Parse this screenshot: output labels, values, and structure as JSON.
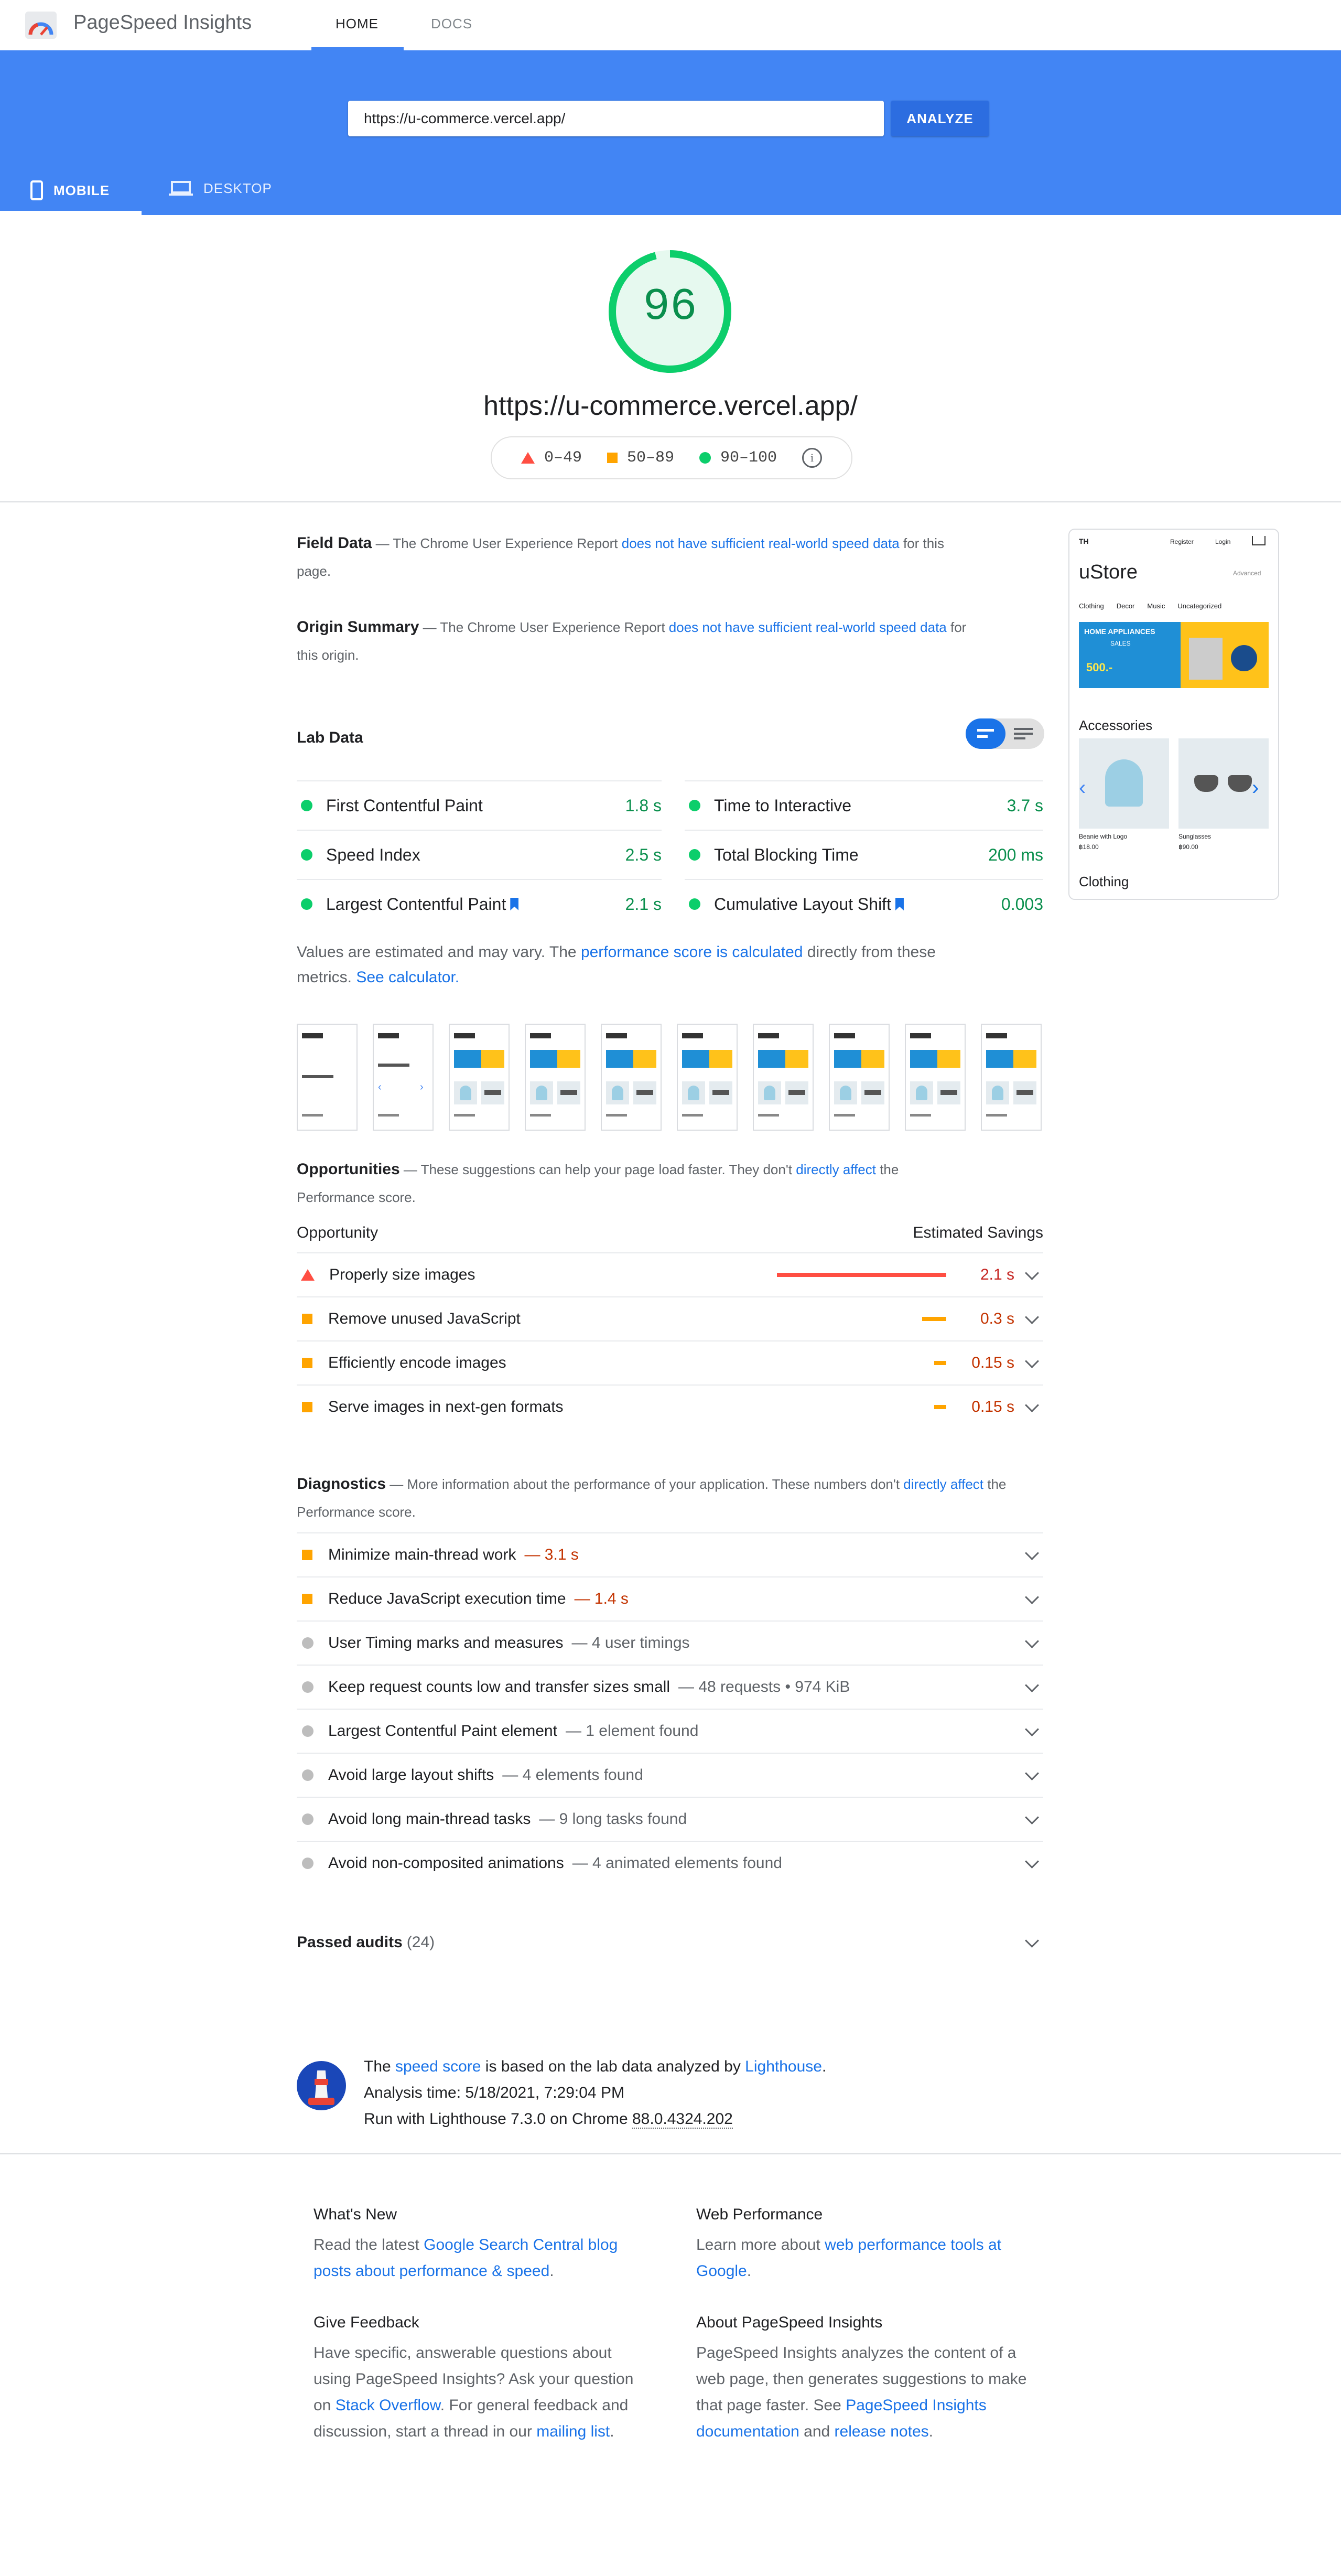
{
  "app": {
    "title": "PageSpeed Insights"
  },
  "nav": {
    "tabs": [
      {
        "label": "HOME",
        "active": true
      },
      {
        "label": "DOCS",
        "active": false
      }
    ]
  },
  "search": {
    "value": "https://u-commerce.vercel.app/",
    "analyze_label": "ANALYZE"
  },
  "devices": [
    {
      "label": "MOBILE",
      "icon": "phone-icon",
      "active": true
    },
    {
      "label": "DESKTOP",
      "icon": "laptop-icon",
      "active": false
    }
  ],
  "score": {
    "value": "96",
    "url": "https://u-commerce.vercel.app/",
    "legend": [
      "0–49",
      "50–89",
      "90–100"
    ],
    "color": "#0cce6b"
  },
  "field_data": {
    "title": "Field Data",
    "prefix": " — The Chrome User Experience Report ",
    "link": "does not have sufficient real-world speed data",
    "suffix": " for this page."
  },
  "origin_summary": {
    "title": "Origin Summary",
    "prefix": " — The Chrome User Experience Report ",
    "link": "does not have sufficient real-world speed data",
    "suffix": " for this origin."
  },
  "lab": {
    "title": "Lab Data",
    "metrics_left": [
      {
        "name": "First Contentful Paint",
        "value": "1.8 s"
      },
      {
        "name": "Speed Index",
        "value": "2.5 s"
      },
      {
        "name": "Largest Contentful Paint",
        "value": "2.1 s"
      }
    ],
    "metrics_right": [
      {
        "name": "Time to Interactive",
        "value": "3.7 s"
      },
      {
        "name": "Total Blocking Time",
        "value": "200 ms"
      },
      {
        "name": "Cumulative Layout Shift",
        "value": "0.003"
      }
    ],
    "note_prefix": "Values are estimated and may vary. The ",
    "note_link": "performance score is calculated",
    "note_mid": " directly from these metrics. ",
    "note_link2": "See calculator."
  },
  "preview": {
    "logo": "TH",
    "register": "Register",
    "login": "Login",
    "store": "uStore",
    "advanced": "Advanced",
    "cats": [
      "Clothing",
      "Decor",
      "Music",
      "Uncategorized"
    ],
    "banner_title": "HOME APPLIANCES",
    "banner_sale": "SALES",
    "banner_price": "500.-",
    "section": "Accessories",
    "products": [
      {
        "name": "Beanie with Logo",
        "price": "฿18.00"
      },
      {
        "name": "Sunglasses",
        "price": "฿90.00"
      }
    ],
    "section2": "Clothing"
  },
  "opportunities": {
    "title": "Opportunities",
    "desc_prefix": " — These suggestions can help your page load faster. They don't ",
    "desc_link": "directly affect",
    "desc_suffix": " the Performance score.",
    "col1": "Opportunity",
    "col2": "Estimated Savings",
    "items": [
      {
        "name": "Properly size images",
        "saving": "2.1 s",
        "level": "fail",
        "bar": 0.85
      },
      {
        "name": "Remove unused JavaScript",
        "saving": "0.3 s",
        "level": "average",
        "bar": 0.12
      },
      {
        "name": "Efficiently encode images",
        "saving": "0.15 s",
        "level": "average",
        "bar": 0.06
      },
      {
        "name": "Serve images in next-gen formats",
        "saving": "0.15 s",
        "level": "average",
        "bar": 0.06
      }
    ]
  },
  "diagnostics": {
    "title": "Diagnostics",
    "desc_prefix": " — More information about the performance of your application. These numbers don't ",
    "desc_link": "directly affect",
    "desc_suffix": " the Performance score.",
    "items": [
      {
        "name": "Minimize main-thread work",
        "detail": "— 3.1 s",
        "level": "average"
      },
      {
        "name": "Reduce JavaScript execution time",
        "detail": "— 1.4 s",
        "level": "average"
      },
      {
        "name": "User Timing marks and measures",
        "detail": "— 4 user timings",
        "level": "info"
      },
      {
        "name": "Keep request counts low and transfer sizes small",
        "detail": "— 48 requests • 974 KiB",
        "level": "info"
      },
      {
        "name": "Largest Contentful Paint element",
        "detail": "— 1 element found",
        "level": "info"
      },
      {
        "name": "Avoid large layout shifts",
        "detail": "— 4 elements found",
        "level": "info"
      },
      {
        "name": "Avoid long main-thread tasks",
        "detail": "— 9 long tasks found",
        "level": "info"
      },
      {
        "name": "Avoid non-composited animations",
        "detail": "— 4 animated elements found",
        "level": "info"
      }
    ]
  },
  "passed": {
    "label": "Passed audits",
    "count": "(24)"
  },
  "runtime": {
    "line1_prefix": "The ",
    "line1_link": "speed score",
    "line1_mid": " is based on the lab data analyzed by ",
    "line1_link2": "Lighthouse",
    "line1_suffix": ".",
    "line2": "Analysis time: 5/18/2021, 7:29:04 PM",
    "line3_prefix": "Run with Lighthouse 7.3.0 on Chrome ",
    "line3_version": "88.0.4324.202"
  },
  "footer": {
    "whats_new": {
      "title": "What's New",
      "prefix": "Read the latest ",
      "link": "Google Search Central blog posts about performance & speed",
      "suffix": "."
    },
    "web_perf": {
      "title": "Web Performance",
      "prefix": "Learn more about ",
      "link": "web performance tools at Google",
      "suffix": "."
    },
    "feedback": {
      "title": "Give Feedback",
      "t1": "Have specific, answerable questions about using PageSpeed Insights? Ask your question on ",
      "link1": "Stack Overflow",
      "t2": ". For general feedback and discussion, start a thread in our ",
      "link2": "mailing list",
      "t3": "."
    },
    "about": {
      "title": "About PageSpeed Insights",
      "t1": "PageSpeed Insights analyzes the content of a web page, then generates suggestions to make that page faster. See ",
      "link1": "PageSpeed Insights documentation",
      "t2": " and ",
      "link2": "release notes",
      "t3": "."
    }
  },
  "colors": {
    "blue": "#4285f4",
    "pass": "#0cce6b",
    "average": "#ffa400",
    "fail": "#ff4e42",
    "link": "#1a73e8"
  }
}
